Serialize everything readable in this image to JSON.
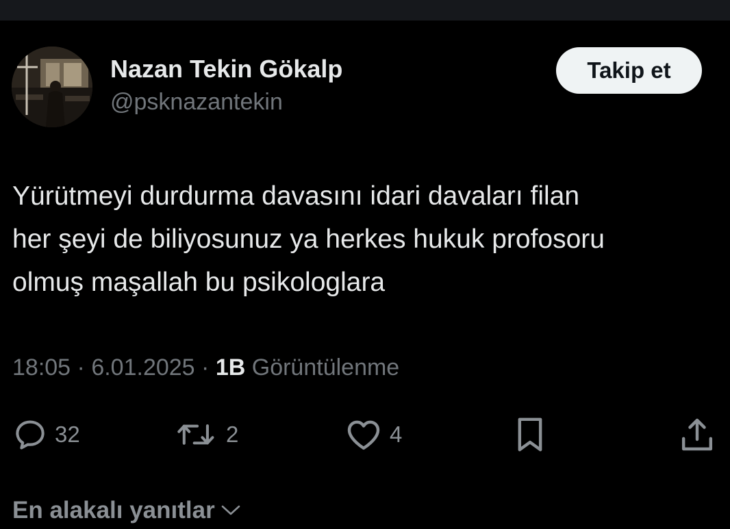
{
  "author": {
    "display_name": "Nazan Tekin Gökalp",
    "handle": "@psknazantekin",
    "avatar_icon": "profile-photo"
  },
  "follow_button": {
    "label": "Takip et"
  },
  "tweet": {
    "lines": [
      "Yürütmeyi durdurma davasını idari davaları filan",
      "her şeyi de biliyosunuz ya herkes hukuk profosoru",
      "olmuş maşallah bu psikologlara"
    ],
    "time": "18:05",
    "date": "6.01.2025",
    "views_count": "1B",
    "views_label": "Görüntülenme"
  },
  "actions": {
    "reply": {
      "icon": "reply-icon",
      "count": "32"
    },
    "retweet": {
      "icon": "retweet-icon",
      "count": "2"
    },
    "like": {
      "icon": "heart-icon",
      "count": "4"
    },
    "bookmark": {
      "icon": "bookmark-icon"
    },
    "share": {
      "icon": "share-icon"
    }
  },
  "replies_sort": {
    "label": "En alakalı yanıtlar",
    "icon": "chevron-down-icon"
  },
  "colors": {
    "background": "#000000",
    "primary_text": "#e7e9ea",
    "secondary_text": "#71767b",
    "follow_button_bg": "#eff3f4",
    "follow_button_text": "#0f1419"
  }
}
